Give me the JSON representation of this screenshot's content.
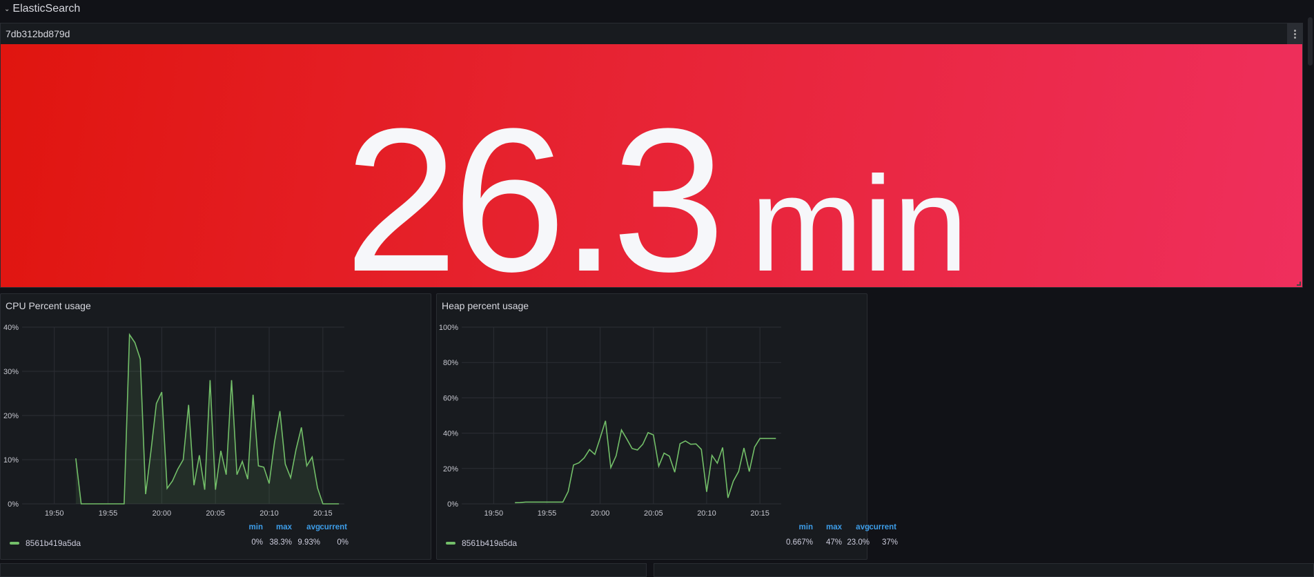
{
  "row": {
    "title": "ElasticSearch",
    "collapse_icon": "chevron-down-icon"
  },
  "stat_panel": {
    "title": "7db312bd879d",
    "value": "26.3",
    "unit": "min",
    "colors": [
      "#e0150f",
      "#ef2f5d"
    ]
  },
  "chart_data": [
    {
      "type": "area",
      "title": "CPU Percent usage",
      "xlabel": "",
      "ylabel": "",
      "x_ticks": [
        "19:50",
        "19:55",
        "20:00",
        "20:05",
        "20:10",
        "20:15"
      ],
      "y_ticks": [
        "0%",
        "10%",
        "20%",
        "30%",
        "40%"
      ],
      "ylim": [
        0,
        40
      ],
      "xlim": [
        "19:47",
        "20:17"
      ],
      "x_start": "19:52",
      "x_step_seconds": 30,
      "grid": true,
      "series": [
        {
          "name": "8561b419a5da",
          "color": "#73bf69",
          "values": [
            10.3,
            0,
            0,
            0,
            0,
            0,
            0,
            0,
            0,
            0,
            38.3,
            36.5,
            32.8,
            2.2,
            12,
            22.7,
            25.3,
            3.5,
            5.2,
            7.9,
            10,
            22.4,
            4.2,
            11,
            3.2,
            28,
            3.2,
            12,
            6.6,
            28,
            6.6,
            9.6,
            5.6,
            24.7,
            8.6,
            8.3,
            4.6,
            14,
            21,
            9,
            5.9,
            12.3,
            17.3,
            8.6,
            10.6,
            3.6,
            0,
            0,
            0,
            0
          ]
        }
      ],
      "legend": {
        "headers": [
          "min",
          "max",
          "avg",
          "current"
        ],
        "values": [
          "0%",
          "38.3%",
          "9.93%",
          "0%"
        ]
      }
    },
    {
      "type": "line",
      "title": "Heap percent usage",
      "xlabel": "",
      "ylabel": "",
      "x_ticks": [
        "19:50",
        "19:55",
        "20:00",
        "20:05",
        "20:10",
        "20:15"
      ],
      "y_ticks": [
        "0%",
        "20%",
        "40%",
        "60%",
        "80%",
        "100%"
      ],
      "ylim": [
        0,
        100
      ],
      "xlim": [
        "19:47",
        "20:17"
      ],
      "x_start": "19:52",
      "x_step_seconds": 30,
      "grid": true,
      "series": [
        {
          "name": "8561b419a5da",
          "color": "#73bf69",
          "values": [
            0.667,
            0.7,
            1,
            1,
            1,
            1,
            1,
            1,
            1,
            1,
            7,
            22,
            23.2,
            26,
            30.7,
            28,
            37.3,
            47,
            20.5,
            27.2,
            41.8,
            36.7,
            31.3,
            30.5,
            33.7,
            40.3,
            39,
            21.3,
            28.7,
            27,
            17.9,
            34,
            35.6,
            33.7,
            33.9,
            30.8,
            6.8,
            27.4,
            23,
            31.9,
            3.4,
            12.8,
            18.3,
            31.6,
            18.3,
            32.1,
            37,
            37,
            37,
            37
          ]
        }
      ],
      "legend": {
        "headers": [
          "min",
          "max",
          "avg",
          "current"
        ],
        "values": [
          "0.667%",
          "47%",
          "23.0%",
          "37%"
        ]
      }
    }
  ]
}
